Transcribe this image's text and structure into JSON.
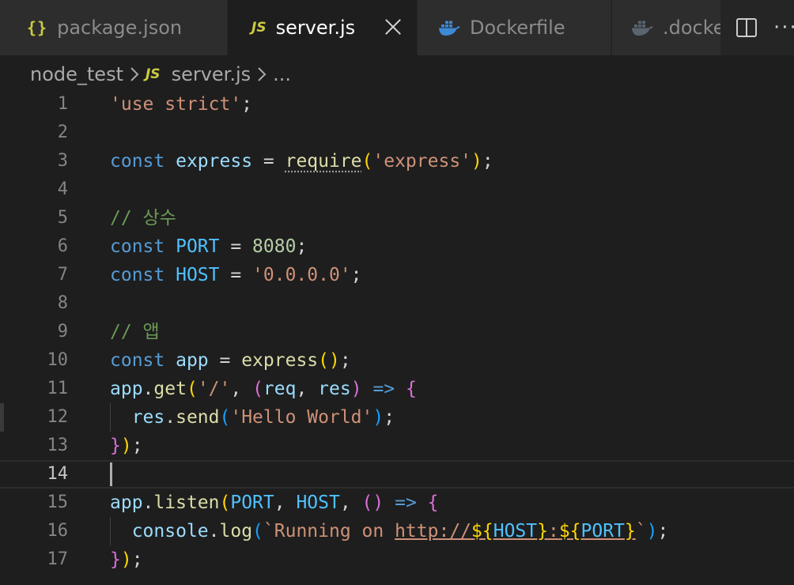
{
  "tabs": [
    {
      "label": "package.json",
      "icon": "json-icon",
      "glyph": "{}",
      "active": false
    },
    {
      "label": "server.js",
      "icon": "js-icon",
      "glyph": "JS",
      "active": true
    },
    {
      "label": "Dockerfile",
      "icon": "docker-icon",
      "active": false
    },
    {
      "label": ".docke",
      "icon": "docker-icon",
      "active": false
    }
  ],
  "breadcrumb": {
    "folder": "node_test",
    "file": "server.js",
    "file_glyph": "JS",
    "trail": "..."
  },
  "editor": {
    "current_line": 14,
    "lines": [
      {
        "n": "1",
        "tokens": [
          {
            "t": "'use strict'",
            "c": "str"
          },
          {
            "t": ";",
            "c": ""
          }
        ]
      },
      {
        "n": "2",
        "tokens": []
      },
      {
        "n": "3",
        "tokens": [
          {
            "t": "const",
            "c": "kw"
          },
          {
            "t": " ",
            "c": ""
          },
          {
            "t": "express",
            "c": "var"
          },
          {
            "t": " = ",
            "c": ""
          },
          {
            "t": "require",
            "c": "fn dots"
          },
          {
            "t": "(",
            "c": "p1"
          },
          {
            "t": "'express'",
            "c": "str"
          },
          {
            "t": ")",
            "c": "p1"
          },
          {
            "t": ";",
            "c": ""
          }
        ]
      },
      {
        "n": "4",
        "tokens": []
      },
      {
        "n": "5",
        "tokens": [
          {
            "t": "// 상수",
            "c": "cmt"
          }
        ]
      },
      {
        "n": "6",
        "tokens": [
          {
            "t": "const",
            "c": "kw"
          },
          {
            "t": " ",
            "c": ""
          },
          {
            "t": "PORT",
            "c": "cst"
          },
          {
            "t": " = ",
            "c": ""
          },
          {
            "t": "8080",
            "c": "num"
          },
          {
            "t": ";",
            "c": ""
          }
        ]
      },
      {
        "n": "7",
        "tokens": [
          {
            "t": "const",
            "c": "kw"
          },
          {
            "t": " ",
            "c": ""
          },
          {
            "t": "HOST",
            "c": "cst"
          },
          {
            "t": " = ",
            "c": ""
          },
          {
            "t": "'0.0.0.0'",
            "c": "str"
          },
          {
            "t": ";",
            "c": ""
          }
        ]
      },
      {
        "n": "8",
        "tokens": []
      },
      {
        "n": "9",
        "tokens": [
          {
            "t": "// 앱",
            "c": "cmt"
          }
        ]
      },
      {
        "n": "10",
        "tokens": [
          {
            "t": "const",
            "c": "kw"
          },
          {
            "t": " ",
            "c": ""
          },
          {
            "t": "app",
            "c": "var"
          },
          {
            "t": " = ",
            "c": ""
          },
          {
            "t": "express",
            "c": "fn"
          },
          {
            "t": "()",
            "c": "p1"
          },
          {
            "t": ";",
            "c": ""
          }
        ]
      },
      {
        "n": "11",
        "tokens": [
          {
            "t": "app",
            "c": "var"
          },
          {
            "t": ".",
            "c": ""
          },
          {
            "t": "get",
            "c": "fn"
          },
          {
            "t": "(",
            "c": "p1"
          },
          {
            "t": "'/'",
            "c": "str"
          },
          {
            "t": ", ",
            "c": ""
          },
          {
            "t": "(",
            "c": "p2"
          },
          {
            "t": "req",
            "c": "var"
          },
          {
            "t": ", ",
            "c": ""
          },
          {
            "t": "res",
            "c": "var"
          },
          {
            "t": ")",
            "c": "p2"
          },
          {
            "t": " ",
            "c": ""
          },
          {
            "t": "=>",
            "c": "kw"
          },
          {
            "t": " ",
            "c": ""
          },
          {
            "t": "{",
            "c": "p2"
          }
        ]
      },
      {
        "n": "12",
        "indent": true,
        "tokens": [
          {
            "t": "  ",
            "c": ""
          },
          {
            "t": "res",
            "c": "var"
          },
          {
            "t": ".",
            "c": ""
          },
          {
            "t": "send",
            "c": "fn"
          },
          {
            "t": "(",
            "c": "p3"
          },
          {
            "t": "'Hello World'",
            "c": "str"
          },
          {
            "t": ")",
            "c": "p3"
          },
          {
            "t": ";",
            "c": ""
          }
        ]
      },
      {
        "n": "13",
        "tokens": [
          {
            "t": "}",
            "c": "p2"
          },
          {
            "t": ")",
            "c": "p1"
          },
          {
            "t": ";",
            "c": ""
          }
        ]
      },
      {
        "n": "14",
        "tokens": []
      },
      {
        "n": "15",
        "tokens": [
          {
            "t": "app",
            "c": "var"
          },
          {
            "t": ".",
            "c": ""
          },
          {
            "t": "listen",
            "c": "fn"
          },
          {
            "t": "(",
            "c": "p1"
          },
          {
            "t": "PORT",
            "c": "cst"
          },
          {
            "t": ", ",
            "c": ""
          },
          {
            "t": "HOST",
            "c": "cst"
          },
          {
            "t": ", ",
            "c": ""
          },
          {
            "t": "()",
            "c": "p2"
          },
          {
            "t": " ",
            "c": ""
          },
          {
            "t": "=>",
            "c": "kw"
          },
          {
            "t": " ",
            "c": ""
          },
          {
            "t": "{",
            "c": "p2"
          }
        ]
      },
      {
        "n": "16",
        "indent": true,
        "tokens": [
          {
            "t": "  ",
            "c": ""
          },
          {
            "t": "console",
            "c": "var"
          },
          {
            "t": ".",
            "c": ""
          },
          {
            "t": "log",
            "c": "fn"
          },
          {
            "t": "(",
            "c": "p3"
          },
          {
            "t": "`Running on ",
            "c": "str"
          },
          {
            "t": "http://",
            "c": "str link"
          },
          {
            "t": "${",
            "c": "p1 link"
          },
          {
            "t": "HOST",
            "c": "cst link"
          },
          {
            "t": "}",
            "c": "p1 link"
          },
          {
            "t": ":",
            "c": "str link"
          },
          {
            "t": "${",
            "c": "p1 link"
          },
          {
            "t": "PORT",
            "c": "cst link"
          },
          {
            "t": "}",
            "c": "p1 link"
          },
          {
            "t": "`",
            "c": "str"
          },
          {
            "t": ")",
            "c": "p3"
          },
          {
            "t": ";",
            "c": ""
          }
        ]
      },
      {
        "n": "17",
        "tokens": [
          {
            "t": "}",
            "c": "p2"
          },
          {
            "t": ")",
            "c": "p1"
          },
          {
            "t": ";",
            "c": ""
          }
        ]
      }
    ]
  },
  "colors": {
    "editor_bg": "#1e1e1e",
    "tab_inactive_bg": "#2d2d2d",
    "keyword": "#569cd6",
    "string": "#ce9178",
    "function": "#dcdcaa",
    "variable": "#9cdcfe",
    "constant": "#4fc1ff",
    "number": "#b5cea8",
    "comment": "#6a9955"
  }
}
